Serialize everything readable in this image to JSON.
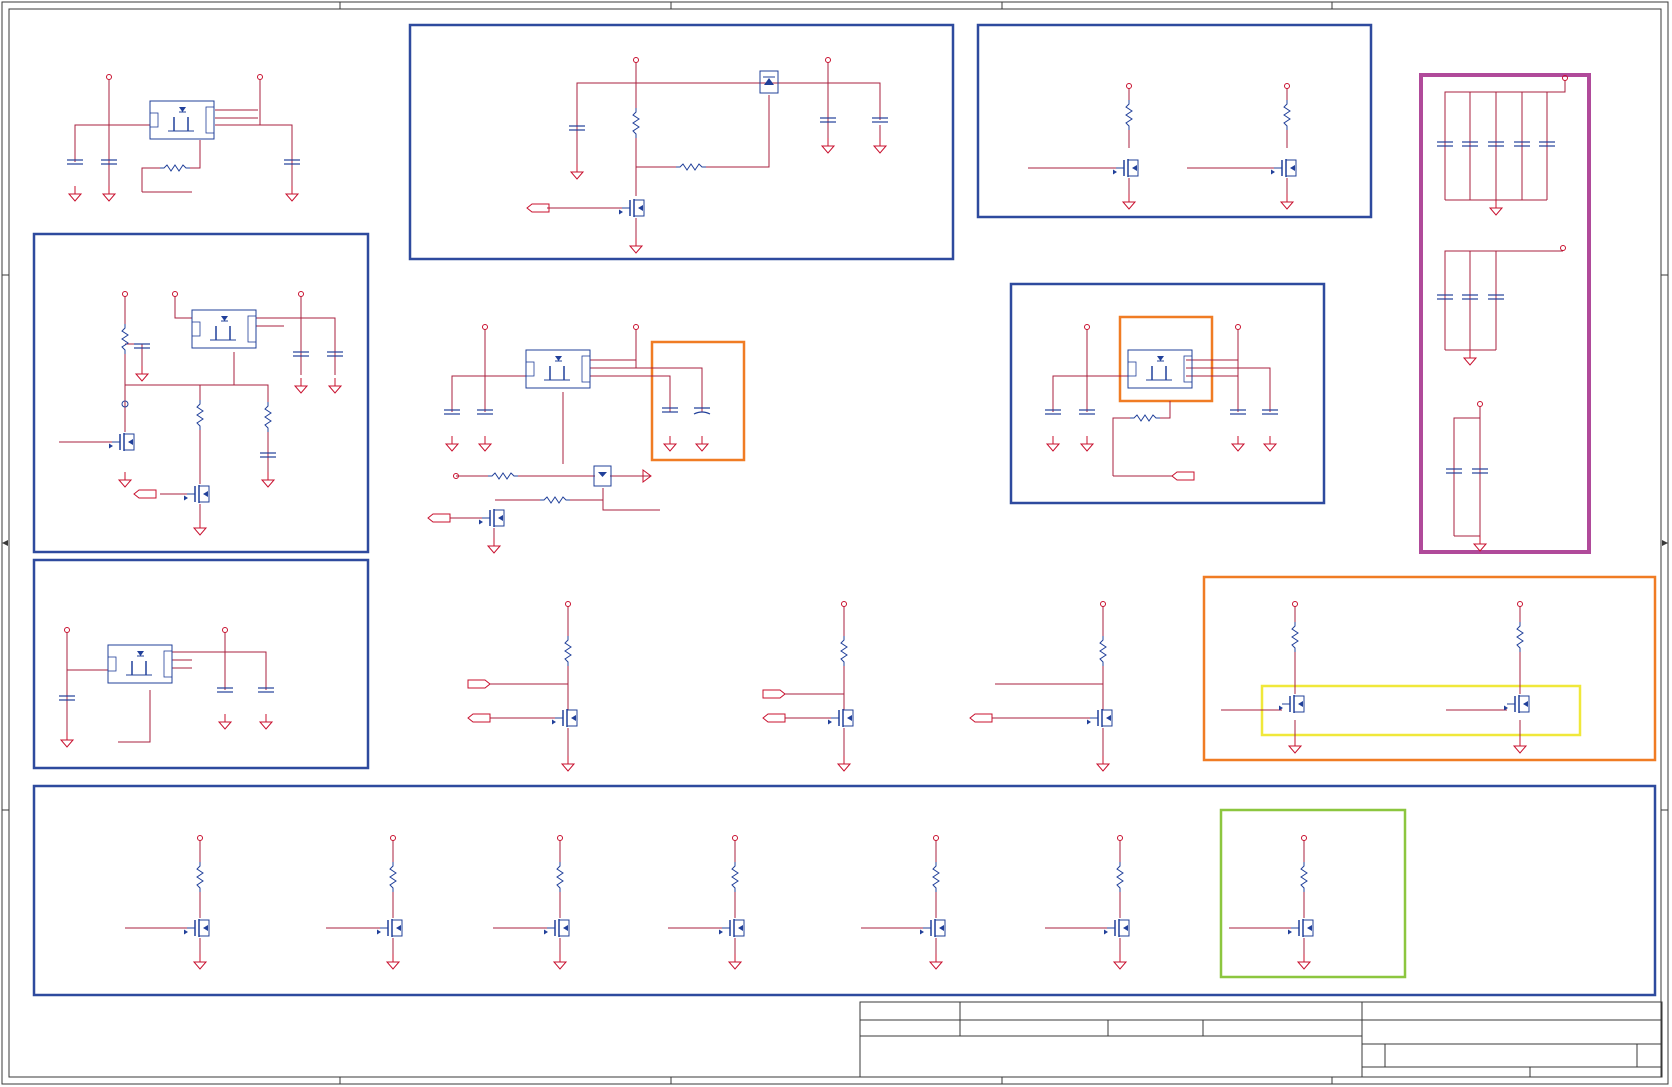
{
  "colors": {
    "wire": "#a8213f",
    "power": "#c8102e",
    "component": "#21409a",
    "frame": "#3a3a3a",
    "box_blue": "#2e4a9e",
    "box_purple": "#b04a9a",
    "box_orange": "#f07c24",
    "box_yellow": "#f0e83a",
    "box_green": "#8cc63f"
  },
  "symbols": [
    "mosfet",
    "resistor",
    "capacitor",
    "ground",
    "power-pin",
    "port-flag",
    "regulator-ic",
    "diode"
  ],
  "highlight_boxes": [
    "blue",
    "purple",
    "orange",
    "yellow",
    "green"
  ]
}
